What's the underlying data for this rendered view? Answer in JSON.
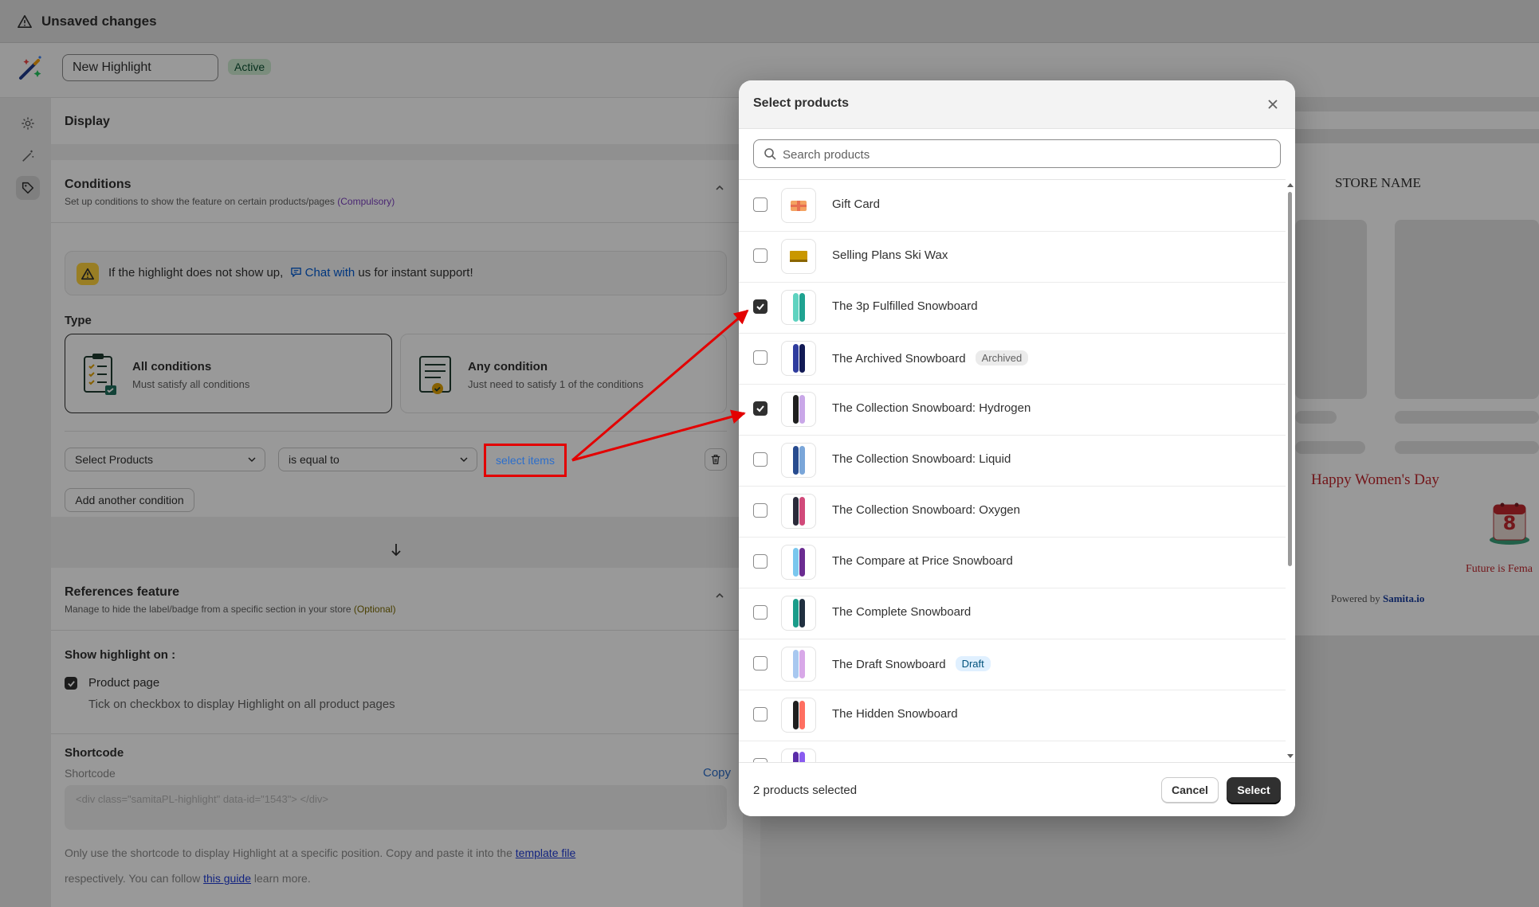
{
  "topbar": {
    "title": "Unsaved changes"
  },
  "header": {
    "name_value": "New Highlight",
    "status": "Active"
  },
  "display": {
    "title": "Display"
  },
  "conditions": {
    "title": "Conditions",
    "subtitle": "Set up conditions to show the feature on certain products/pages",
    "subtitle_tag": "(Compulsory)",
    "notice_pre": "If the highlight does not show up,",
    "notice_link": "Chat with",
    "notice_post": "us for instant support!",
    "type_label": "Type",
    "types": [
      {
        "title": "All conditions",
        "desc": "Must satisfy all conditions",
        "selected": true
      },
      {
        "title": "Any condition",
        "desc": "Just need to satisfy 1 of the conditions",
        "selected": false
      }
    ],
    "field_select": "Select Products",
    "operator_select": "is equal to",
    "select_items": "select items",
    "add_condition": "Add another condition"
  },
  "references": {
    "title": "References feature",
    "subtitle": "Manage to hide the label/badge from a specific section in your store",
    "subtitle_tag": "(Optional)",
    "show_on_label": "Show highlight on :",
    "product_page_label": "Product page",
    "product_page_checked": true,
    "product_page_hint": "Tick on checkbox to display Highlight on all product pages"
  },
  "shortcode": {
    "title": "Shortcode",
    "label": "Shortcode",
    "copy": "Copy",
    "code": "<div class=\"samitaPL-highlight\" data-id=\"1543\"> </div>",
    "help_pre": "Only use the shortcode to display Highlight at a specific position. Copy and paste it into the",
    "help_link": "template file",
    "help2_pre": "respectively. You can follow",
    "help2_link": "this guide",
    "help2_post": "learn more."
  },
  "preview": {
    "store_name": "STORE NAME",
    "headline": "Happy Women's Day",
    "tagline": "Future is Fema",
    "calendar_number": "8",
    "powered_pre": "Powered by",
    "powered_brand": "Samita.io"
  },
  "modal": {
    "title": "Select products",
    "search_placeholder": "Search products",
    "products": [
      {
        "name": "Gift Card",
        "checked": false,
        "badge": "",
        "thumb": "gift-card"
      },
      {
        "name": "Selling Plans Ski Wax",
        "checked": false,
        "badge": "",
        "thumb": "ski-wax"
      },
      {
        "name": "The 3p Fulfilled Snowboard",
        "checked": true,
        "badge": "",
        "thumb": "snowboard-teal"
      },
      {
        "name": "The Archived Snowboard",
        "checked": false,
        "badge": "Archived",
        "thumb": "snowboard-navy"
      },
      {
        "name": "The Collection Snowboard: Hydrogen",
        "checked": true,
        "badge": "",
        "thumb": "snowboard-black-lilac"
      },
      {
        "name": "The Collection Snowboard: Liquid",
        "checked": false,
        "badge": "",
        "thumb": "snowboard-blue"
      },
      {
        "name": "The Collection Snowboard: Oxygen",
        "checked": false,
        "badge": "",
        "thumb": "snowboard-dark-pink"
      },
      {
        "name": "The Compare at Price Snowboard",
        "checked": false,
        "badge": "",
        "thumb": "snowboard-sky-purple"
      },
      {
        "name": "The Complete Snowboard",
        "checked": false,
        "badge": "",
        "thumb": "snowboard-teal-pattern"
      },
      {
        "name": "The Draft Snowboard",
        "checked": false,
        "badge": "Draft",
        "thumb": "snowboard-pastel"
      },
      {
        "name": "The Hidden Snowboard",
        "checked": false,
        "badge": "",
        "thumb": "snowboard-black-sunset"
      },
      {
        "name": "",
        "checked": false,
        "badge": "",
        "thumb": "snowboard-purple"
      }
    ],
    "selected_count": "2 products selected",
    "cancel": "Cancel",
    "select": "Select"
  },
  "colors": {
    "annotation_red": "#e30000",
    "primary": "#303030",
    "link": "#005bd3"
  }
}
